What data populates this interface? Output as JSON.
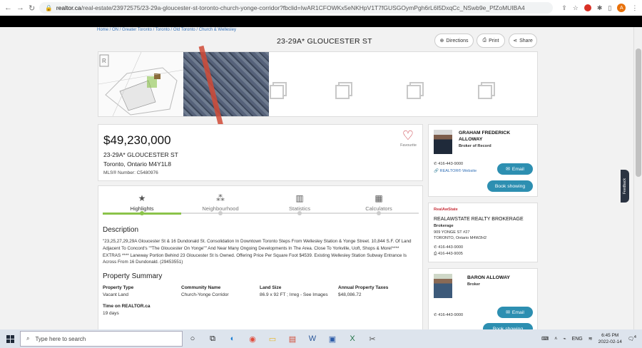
{
  "browser": {
    "url_host": "realtor.ca",
    "url_path": "/real-estate/23972575/23-29a-gloucester-st-toronto-church-yonge-corridor?fbclid=IwAR1CFOWKx5eNKHpV1T7fGUSGOymPgh6rL6l5DxqCc_NSwb9e_PfZoMUIBA4",
    "profile_initial": "A"
  },
  "breadcrumb": "Home / ON / Greater Toronto / Toronto / Old Toronto / Church & Wellesley",
  "page_title": "23-29A* GLOUCESTER ST",
  "actions": {
    "directions": "Directions",
    "print": "Print",
    "share": "Share"
  },
  "listing": {
    "price": "$49,230,000",
    "address_line1": "23-29A* GLOUCESTER ST",
    "address_line2": "Toronto, Ontario M4Y1L8",
    "mls": "MLS® Number: C5480976",
    "favourite": "Favourite"
  },
  "tabs": [
    {
      "label": "Highlights",
      "icon": "star-icon"
    },
    {
      "label": "Neighbourhood",
      "icon": "people-icon"
    },
    {
      "label": "Statistics",
      "icon": "bar-chart-icon"
    },
    {
      "label": "Calculators",
      "icon": "calculator-icon"
    }
  ],
  "description": {
    "heading": "Description",
    "text": "\"23,25,27,29,29A Gloucester St & 16 Dundonald St. Consolidation In Downtown Toronto Steps From Wellesley Station & Yonge Street. 10,844 S.F. Of Land Adjacent To Concord's \"\"The Gloucester On Yonge\"\" And Near Many Ongoing Developments In The Area. Close To Yorkville, Uoft, Shops & More!**** EXTRAS **** Laneway Portion Behind 23 Gloucester St Is Owned. Offering Price Per Square Foot $4539. Existing Wellesley Station Subway Entrance Is Across From 16 Dundonald. (29453551)"
  },
  "summary": {
    "heading": "Property Summary",
    "items": [
      {
        "label": "Property Type",
        "value": "Vacant Land"
      },
      {
        "label": "Community Name",
        "value": "Church-Yonge Corridor"
      },
      {
        "label": "Land Size",
        "value": "86.9 x 92 FT ; Irreg - See Images"
      },
      {
        "label": "Annual Property Taxes",
        "value": "$48,086.72"
      },
      {
        "label": "Time on REALTOR.ca",
        "value": "19 days"
      }
    ]
  },
  "agent1": {
    "name_line1": "GRAHAM FREDERICK",
    "name_line2": "ALLOWAY",
    "role": "Broker of Record",
    "phone": "416-443-9000",
    "website": "REALTOR® Website",
    "email": "Email",
    "book": "Book showing"
  },
  "brokerage": {
    "logo_text": "RealAwState",
    "name": "REALAWSTATE REALTY BROKERAGE",
    "type": "Brokerage",
    "addr1": "909 YONGE ST #27",
    "addr2": "TORONTO, Ontario M4W2H2",
    "phone": "416-443-9000",
    "fax": "416-443-9005"
  },
  "agent2": {
    "name": "BARON ALLOWAY",
    "role": "Broker",
    "phone": "416-443-9000",
    "email": "Email",
    "book": "Book showing"
  },
  "feedback": "Feedback",
  "taskbar": {
    "search_placeholder": "Type here to search",
    "lang": "ENG",
    "time": "6:45 PM",
    "date": "2022-02-14",
    "notif_count": "4"
  }
}
